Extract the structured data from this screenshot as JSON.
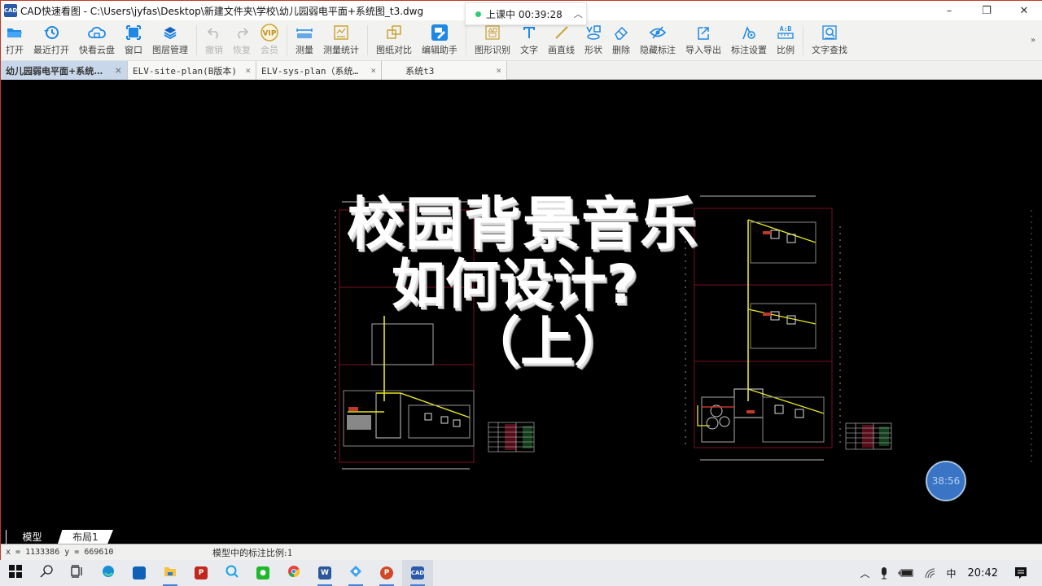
{
  "window": {
    "title": "CAD快速看图 - C:\\Users\\jyfas\\Desktop\\新建文件夹\\学校\\幼儿园弱电平面+系统图_t3.dwg",
    "app_icon_label": "CAD",
    "controls": {
      "minimize": "–",
      "maximize": "❐",
      "close": "✕"
    }
  },
  "class_timer": {
    "label": "上课中 00:39:28",
    "status_color": "#2ecc71"
  },
  "toolbar": {
    "items": [
      {
        "label": "打开",
        "icon": "folder-open-icon",
        "enabled": true
      },
      {
        "label": "最近打开",
        "icon": "history-icon",
        "enabled": true
      },
      {
        "label": "快看云盘",
        "icon": "cloud-icon",
        "enabled": true
      },
      {
        "label": "窗口",
        "icon": "window-frame-icon",
        "enabled": true
      },
      {
        "label": "图层管理",
        "icon": "layers-icon",
        "enabled": true
      },
      {
        "label": "撤销",
        "icon": "undo-icon",
        "enabled": false
      },
      {
        "label": "恢复",
        "icon": "redo-icon",
        "enabled": false
      },
      {
        "label": "会员",
        "icon": "vip-icon",
        "enabled": false
      },
      {
        "label": "测量",
        "icon": "ruler-icon",
        "enabled": true
      },
      {
        "label": "测量统计",
        "icon": "measure-stats-icon",
        "enabled": true
      },
      {
        "label": "图纸对比",
        "icon": "compare-icon",
        "enabled": true
      },
      {
        "label": "编辑助手",
        "icon": "edit-assistant-icon",
        "enabled": true
      },
      {
        "label": "图形识别",
        "icon": "shape-recognize-icon",
        "enabled": true
      },
      {
        "label": "文字",
        "icon": "text-icon",
        "enabled": true
      },
      {
        "label": "画直线",
        "icon": "line-icon",
        "enabled": true
      },
      {
        "label": "形状",
        "icon": "shapes-icon",
        "enabled": true
      },
      {
        "label": "删除",
        "icon": "eraser-icon",
        "enabled": true
      },
      {
        "label": "隐藏标注",
        "icon": "hide-eye-icon",
        "enabled": true
      },
      {
        "label": "导入导出",
        "icon": "import-export-icon",
        "enabled": true
      },
      {
        "label": "标注设置",
        "icon": "annotation-settings-icon",
        "enabled": true
      },
      {
        "label": "比例",
        "icon": "scale-icon",
        "enabled": true
      },
      {
        "label": "文字查找",
        "icon": "text-search-icon",
        "enabled": true
      }
    ],
    "more_label": "»"
  },
  "tabs": [
    {
      "label": "幼儿园弱电平面+系统…",
      "active": true
    },
    {
      "label": "ELV-site-plan(B版本)",
      "active": false
    },
    {
      "label": "ELV-sys-plan（系统…",
      "active": false
    },
    {
      "label": "系统t3",
      "active": false
    }
  ],
  "tab_close": "×",
  "canvas": {
    "overlay_title": {
      "line1": "校园背景音乐",
      "line2": "如何设计?",
      "line3": "（上）"
    },
    "timer_bubble": "38:56"
  },
  "layout_tabs": [
    {
      "label": "模型",
      "active": true
    },
    {
      "label": "布局1",
      "active": false
    }
  ],
  "status": {
    "coordinates": "x = 1133386 y = 669610",
    "annotation_scale": "模型中的标注比例:1"
  },
  "taskbar": {
    "apps": [
      {
        "name": "start"
      },
      {
        "name": "search"
      },
      {
        "name": "task-view"
      },
      {
        "name": "edge"
      },
      {
        "name": "store"
      },
      {
        "name": "file-explorer"
      },
      {
        "name": "pdf"
      },
      {
        "name": "chat-bubble"
      },
      {
        "name": "wechat"
      },
      {
        "name": "chrome"
      },
      {
        "name": "word"
      },
      {
        "name": "feishu"
      },
      {
        "name": "powerpoint"
      },
      {
        "name": "cad-viewer"
      }
    ],
    "tray": {
      "ime": "中",
      "time": "20:42"
    }
  }
}
